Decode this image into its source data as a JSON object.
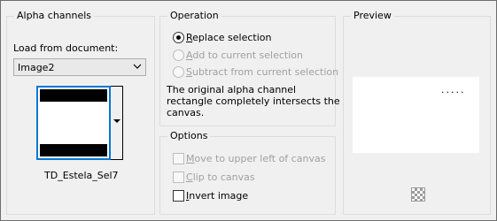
{
  "alpha": {
    "legend": "Alpha channels",
    "load_label": "Load from document:",
    "document_value": "Image2",
    "channel_name": "TD_Estela_Sel7"
  },
  "operation": {
    "legend": "Operation",
    "radios": [
      {
        "label": "Replace selection",
        "checked": true,
        "enabled": true
      },
      {
        "label": "Add to current selection",
        "checked": false,
        "enabled": false
      },
      {
        "label": "Subtract from current selection",
        "checked": false,
        "enabled": false
      }
    ],
    "description": [
      "The original alpha channel",
      "rectangle completely intersects the",
      "canvas."
    ]
  },
  "options": {
    "legend": "Options",
    "checks": [
      {
        "label": "Move to upper left of canvas",
        "checked": false,
        "enabled": false
      },
      {
        "label": "Clip to canvas",
        "checked": false,
        "enabled": false
      },
      {
        "label": "Invert image",
        "checked": false,
        "enabled": true
      }
    ]
  },
  "preview": {
    "legend": "Preview",
    "marker": "....."
  }
}
